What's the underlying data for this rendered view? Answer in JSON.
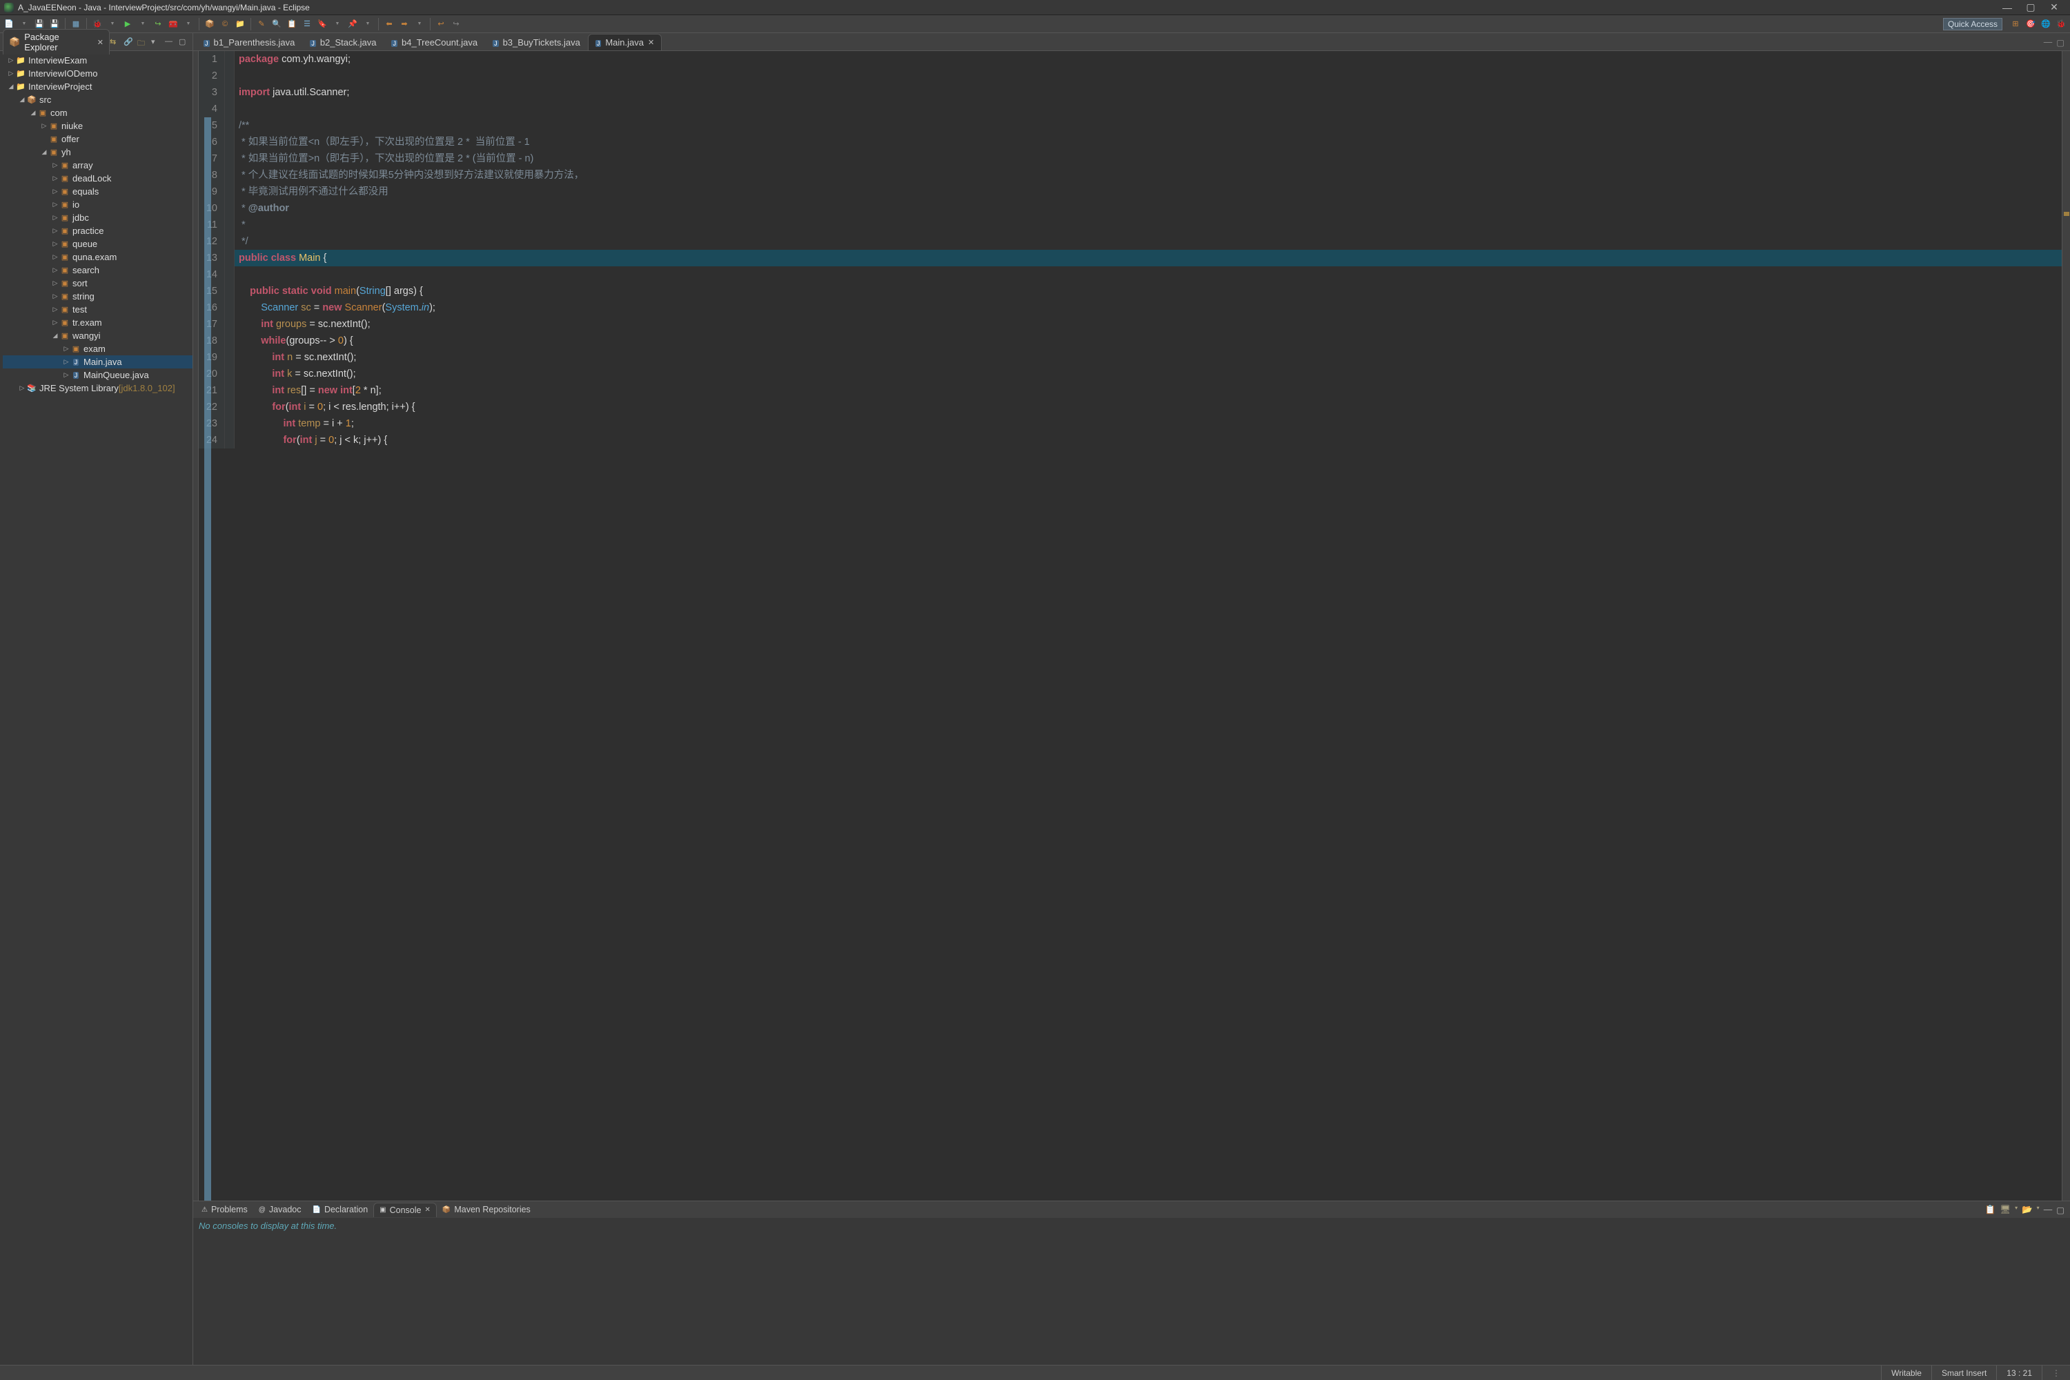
{
  "window": {
    "title": "A_JavaEENeon - Java - InterviewProject/src/com/yh/wangyi/Main.java - Eclipse"
  },
  "quick_access": {
    "label": "Quick Access"
  },
  "pkg_explorer": {
    "title": "Package Explorer",
    "tree": [
      {
        "depth": 0,
        "twist": "closed",
        "icon": "proj",
        "label": "InterviewExam"
      },
      {
        "depth": 0,
        "twist": "closed",
        "icon": "proj",
        "label": "InterviewIODemo"
      },
      {
        "depth": 0,
        "twist": "open",
        "icon": "proj",
        "label": "InterviewProject"
      },
      {
        "depth": 1,
        "twist": "open",
        "icon": "src",
        "label": "src"
      },
      {
        "depth": 2,
        "twist": "open",
        "icon": "pkg",
        "label": "com"
      },
      {
        "depth": 3,
        "twist": "closed",
        "icon": "pkg",
        "label": "niuke"
      },
      {
        "depth": 3,
        "twist": "none",
        "icon": "pkg",
        "label": "offer"
      },
      {
        "depth": 3,
        "twist": "open",
        "icon": "pkg",
        "label": "yh"
      },
      {
        "depth": 4,
        "twist": "closed",
        "icon": "pkg",
        "label": "array"
      },
      {
        "depth": 4,
        "twist": "closed",
        "icon": "pkg",
        "label": "deadLock"
      },
      {
        "depth": 4,
        "twist": "closed",
        "icon": "pkg",
        "label": "equals"
      },
      {
        "depth": 4,
        "twist": "closed",
        "icon": "pkg",
        "label": "io"
      },
      {
        "depth": 4,
        "twist": "closed",
        "icon": "pkg",
        "label": "jdbc"
      },
      {
        "depth": 4,
        "twist": "closed",
        "icon": "pkg",
        "label": "practice"
      },
      {
        "depth": 4,
        "twist": "closed",
        "icon": "pkg",
        "label": "queue"
      },
      {
        "depth": 4,
        "twist": "closed",
        "icon": "pkg",
        "label": "quna.exam"
      },
      {
        "depth": 4,
        "twist": "closed",
        "icon": "pkg",
        "label": "search"
      },
      {
        "depth": 4,
        "twist": "closed",
        "icon": "pkg",
        "label": "sort"
      },
      {
        "depth": 4,
        "twist": "closed",
        "icon": "pkg",
        "label": "string"
      },
      {
        "depth": 4,
        "twist": "closed",
        "icon": "pkg",
        "label": "test"
      },
      {
        "depth": 4,
        "twist": "closed",
        "icon": "pkg",
        "label": "tr.exam"
      },
      {
        "depth": 4,
        "twist": "open",
        "icon": "pkg",
        "label": "wangyi"
      },
      {
        "depth": 5,
        "twist": "closed",
        "icon": "pkg",
        "label": "exam"
      },
      {
        "depth": 5,
        "twist": "closed",
        "icon": "file",
        "label": "Main.java",
        "selected": true
      },
      {
        "depth": 5,
        "twist": "closed",
        "icon": "file",
        "label": "MainQueue.java"
      },
      {
        "depth": 1,
        "twist": "closed",
        "icon": "lib",
        "label": "JRE System Library",
        "suffix": "[jdk1.8.0_102]"
      }
    ]
  },
  "editor_tabs": [
    {
      "label": "b1_Parenthesis.java",
      "active": false
    },
    {
      "label": "b2_Stack.java",
      "active": false
    },
    {
      "label": "b4_TreeCount.java",
      "active": false
    },
    {
      "label": "b3_BuyTickets.java",
      "active": false
    },
    {
      "label": "Main.java",
      "active": true
    }
  ],
  "code_lines": [
    {
      "n": 1,
      "html": "<span class='kw'>package</span> com.yh.wangyi;"
    },
    {
      "n": 2,
      "html": ""
    },
    {
      "n": 3,
      "html": "<span class='kw'>import</span> java.util.Scanner;"
    },
    {
      "n": 4,
      "html": ""
    },
    {
      "n": 5,
      "html": "<span class='cm'>/**</span>"
    },
    {
      "n": 6,
      "html": "<span class='cm'> * 如果当前位置&lt;n（即左手），下次出现的位置是 2 *  当前位置 - 1</span>"
    },
    {
      "n": 7,
      "html": "<span class='cm'> * 如果当前位置&gt;n（即右手），下次出现的位置是 2 * (当前位置 - n)</span>"
    },
    {
      "n": 8,
      "html": "<span class='cm'> * 个人建议在线面试题的时候如果5分钟内没想到好方法建议就使用暴力方法，</span>"
    },
    {
      "n": 9,
      "html": "<span class='cm'> * 毕竟测试用例不通过什么都没用</span>"
    },
    {
      "n": 10,
      "html": "<span class='cm'> * <span class='ann'>@author</span></span>"
    },
    {
      "n": 11,
      "html": "<span class='cm'> *</span>"
    },
    {
      "n": 12,
      "html": "<span class='cm'> */</span>"
    },
    {
      "n": 13,
      "hl": true,
      "html": "<span class='kw'>public</span> <span class='kw'>class</span> <span class='cls'>Main</span> {"
    },
    {
      "n": 14,
      "html": ""
    },
    {
      "n": 15,
      "html": "    <span class='kw'>public</span> <span class='kw'>static</span> <span class='kw'>void</span> <span class='type'>main</span>(<span class='kw2'>String</span>[] args) {"
    },
    {
      "n": 16,
      "html": "        <span class='kw2'>Scanner</span> <span class='var'>sc</span> = <span class='kw'>new</span> <span class='type'>Scanner</span>(<span class='kw2'>System</span>.<span class='id-italic'>in</span>);"
    },
    {
      "n": 17,
      "html": "        <span class='kw'>int</span> <span class='var'>groups</span> = sc.nextInt();"
    },
    {
      "n": 18,
      "html": "        <span class='kw'>while</span>(groups-- &gt; <span class='num'>0</span>) {"
    },
    {
      "n": 19,
      "html": "            <span class='kw'>int</span> <span class='var'>n</span> = sc.nextInt();"
    },
    {
      "n": 20,
      "html": "            <span class='kw'>int</span> <span class='var'>k</span> = sc.nextInt();"
    },
    {
      "n": 21,
      "html": "            <span class='kw'>int</span> <span class='var'>res</span>[] = <span class='kw'>new</span> <span class='kw'>int</span>[<span class='num'>2</span> * n];"
    },
    {
      "n": 22,
      "html": "            <span class='kw'>for</span>(<span class='kw'>int</span> <span class='var'>i</span> = <span class='num'>0</span>; i &lt; res.length; i++) {"
    },
    {
      "n": 23,
      "html": "                <span class='kw'>int</span> <span class='var'>temp</span> = i + <span class='num'>1</span>;"
    },
    {
      "n": 24,
      "html": "                <span class='kw'>for</span>(<span class='kw'>int</span> <span class='var'>j</span> = <span class='num'>0</span>; j &lt; k; j++) {"
    }
  ],
  "bottom_tabs": [
    {
      "label": "Problems",
      "icon": "⚠",
      "active": false
    },
    {
      "label": "Javadoc",
      "icon": "@",
      "active": false
    },
    {
      "label": "Declaration",
      "icon": "📄",
      "active": false
    },
    {
      "label": "Console",
      "icon": "▣",
      "active": true,
      "closable": true
    },
    {
      "label": "Maven Repositories",
      "icon": "📦",
      "active": false
    }
  ],
  "console": {
    "message": "No consoles to display at this time."
  },
  "status": {
    "writable": "Writable",
    "insert": "Smart Insert",
    "pos": "13 : 21"
  }
}
